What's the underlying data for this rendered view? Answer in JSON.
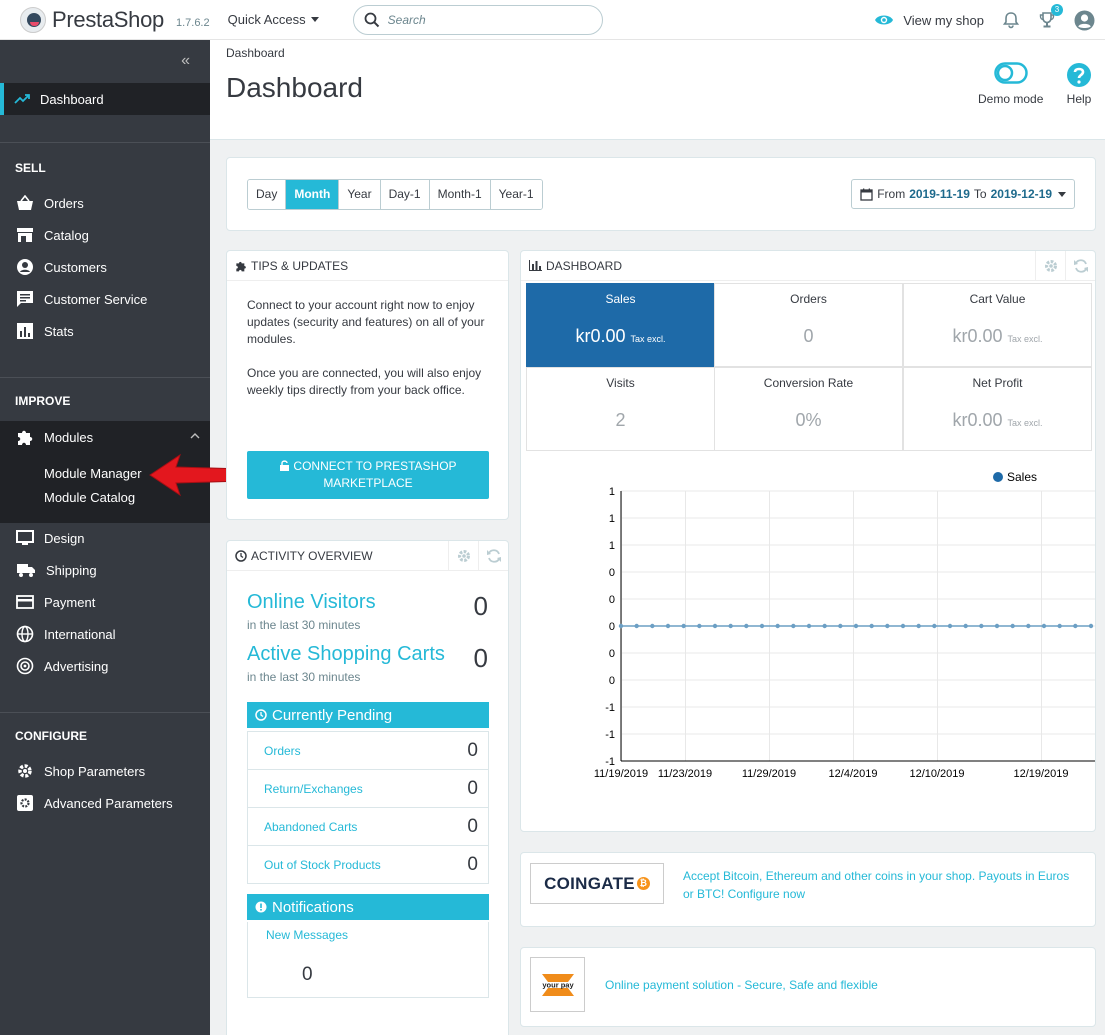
{
  "header": {
    "logo_text": "PrestaShop",
    "version": "1.7.6.2",
    "quick_access": "Quick Access",
    "search_placeholder": "Search",
    "view_shop": "View my shop",
    "trophy_badge": "3"
  },
  "sidebar": {
    "collapse": "«",
    "dashboard": "Dashboard",
    "sell_title": "SELL",
    "sell_items": [
      "Orders",
      "Catalog",
      "Customers",
      "Customer Service",
      "Stats"
    ],
    "improve_title": "IMPROVE",
    "modules": "Modules",
    "module_sub": [
      "Module Manager",
      "Module Catalog"
    ],
    "improve_items": [
      "Design",
      "Shipping",
      "Payment",
      "International",
      "Advertising"
    ],
    "configure_title": "CONFIGURE",
    "configure_items": [
      "Shop Parameters",
      "Advanced Parameters"
    ]
  },
  "page": {
    "breadcrumb": "Dashboard",
    "title": "Dashboard",
    "demo_mode": "Demo mode",
    "help": "Help"
  },
  "period": {
    "buttons": [
      "Day",
      "Month",
      "Year",
      "Day-1",
      "Month-1",
      "Year-1"
    ],
    "active": "Month",
    "from_label": "From",
    "from": "2019-11-19",
    "to_label": "To",
    "to": "2019-12-19"
  },
  "tips": {
    "title": "TIPS & UPDATES",
    "p1": "Connect to your account right now to enjoy updates (security and features) on all of your modules.",
    "p2": "Once you are connected, you will also enjoy weekly tips directly from your back office.",
    "button": "CONNECT TO PRESTASHOP MARKETPLACE"
  },
  "activity": {
    "title": "ACTIVITY OVERVIEW",
    "online_visitors": "Online Visitors",
    "online_visitors_sub": "in the last 30 minutes",
    "online_visitors_val": "0",
    "active_carts": "Active Shopping Carts",
    "active_carts_sub": "in the last 30 minutes",
    "active_carts_val": "0",
    "pending_title": "Currently Pending",
    "pending": [
      {
        "label": "Orders",
        "value": "0"
      },
      {
        "label": "Return/Exchanges",
        "value": "0"
      },
      {
        "label": "Abandoned Carts",
        "value": "0"
      },
      {
        "label": "Out of Stock Products",
        "value": "0"
      }
    ],
    "notif_title": "Notifications",
    "new_messages": "New Messages",
    "new_messages_val": "0"
  },
  "dashboard": {
    "title": "DASHBOARD",
    "kpis": [
      {
        "label": "Sales",
        "value": "kr0.00",
        "suffix": "Tax excl."
      },
      {
        "label": "Orders",
        "value": "0",
        "suffix": ""
      },
      {
        "label": "Cart Value",
        "value": "kr0.00",
        "suffix": "Tax excl."
      },
      {
        "label": "Visits",
        "value": "2",
        "suffix": ""
      },
      {
        "label": "Conversion Rate",
        "value": "0%",
        "suffix": ""
      },
      {
        "label": "Net Profit",
        "value": "kr0.00",
        "suffix": "Tax excl."
      }
    ]
  },
  "chart_data": {
    "type": "line",
    "legend": "Sales",
    "legend_position": "top-right",
    "y_tick_labels": [
      "1",
      "1",
      "1",
      "0",
      "0",
      "0",
      "0",
      "0",
      "-1",
      "-1",
      "-1"
    ],
    "x_tick_labels": [
      "11/19/2019",
      "11/23/2019",
      "11/29/2019",
      "12/4/2019",
      "12/10/2019",
      "12/19/2019"
    ],
    "series": [
      {
        "name": "Sales",
        "values": [
          0,
          0,
          0,
          0,
          0,
          0,
          0,
          0,
          0,
          0,
          0,
          0,
          0,
          0,
          0,
          0,
          0,
          0,
          0,
          0,
          0,
          0,
          0,
          0,
          0,
          0,
          0,
          0,
          0,
          0,
          0
        ]
      }
    ],
    "ylim": [
      -1,
      1
    ],
    "grid": true,
    "color": "#1e6aa8"
  },
  "ads": {
    "coingate_logo": "COINGATE",
    "coingate_text": "Accept Bitcoin, Ethereum and other coins in your shop. Payouts in Euros or BTC! Configure now",
    "yourpay_logo": "your pay",
    "yourpay_text": "Online payment solution - Secure, Safe and flexible"
  },
  "colors": {
    "accent": "#25b9d7",
    "sidebar": "#363a41",
    "sidebar_active": "#202226",
    "kpi_active": "#1e6aa8",
    "arrow": "#e3171e"
  }
}
